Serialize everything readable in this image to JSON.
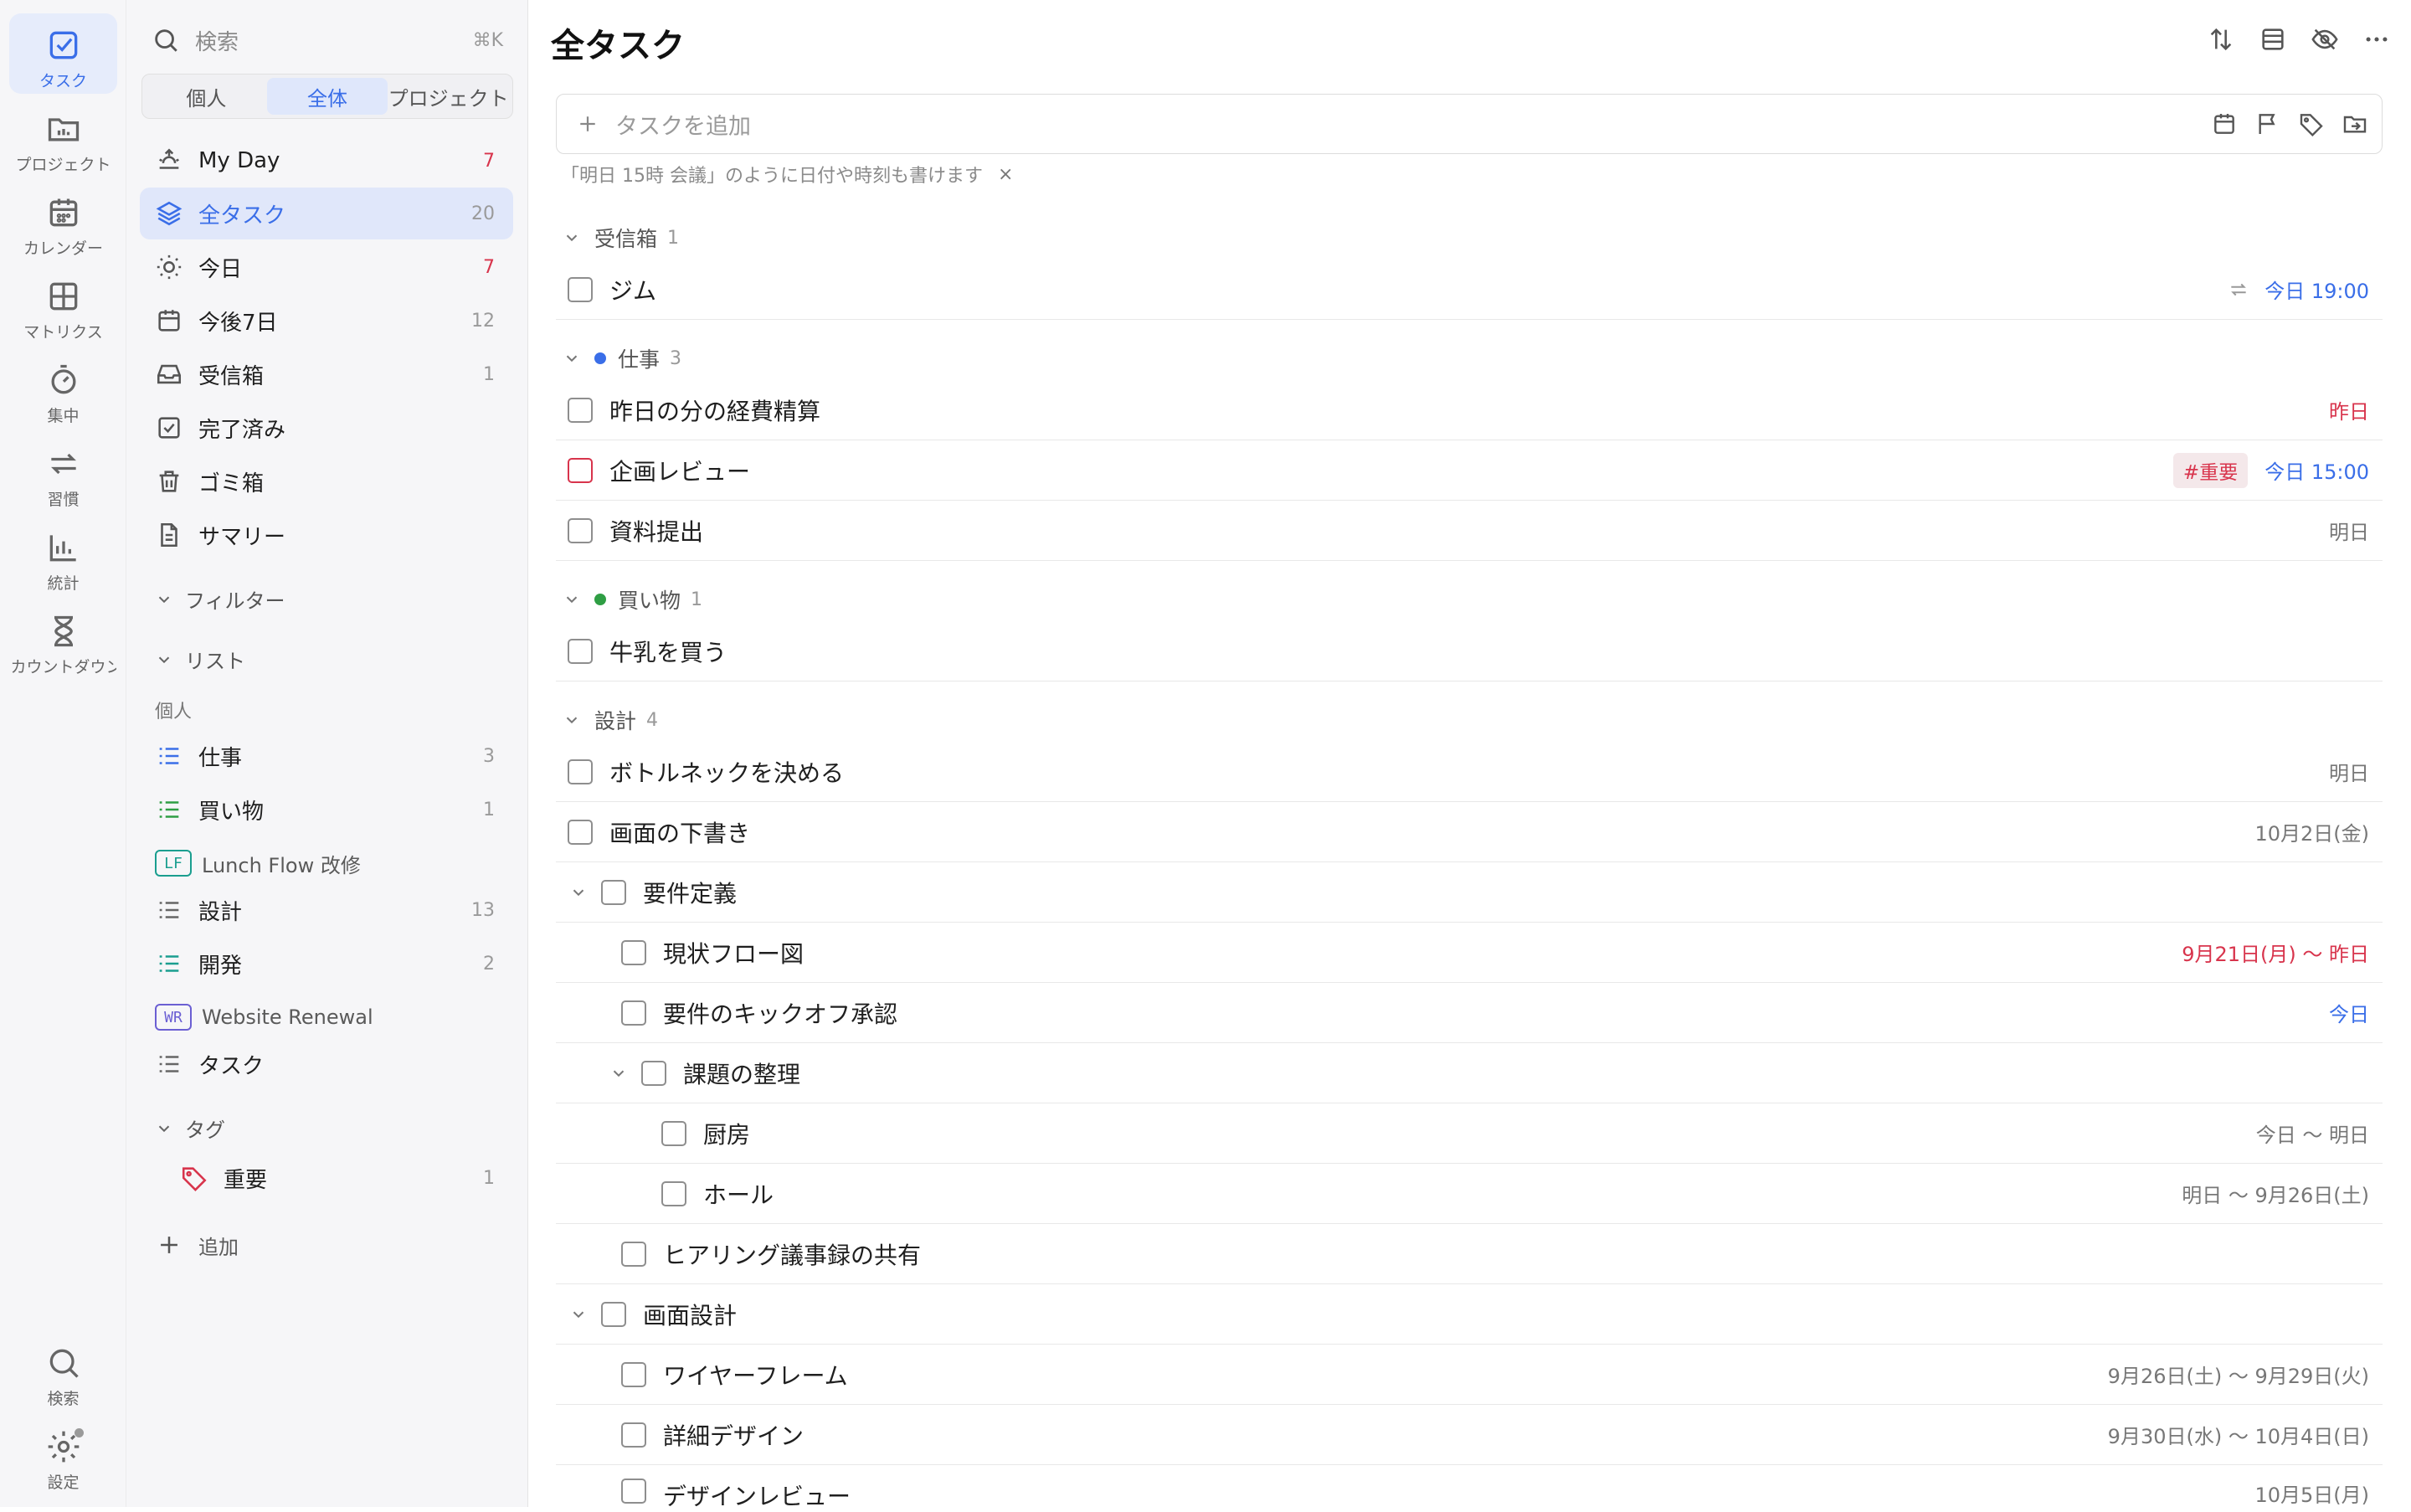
{
  "rail": {
    "tasks": "タスク",
    "projects": "プロジェクト",
    "calendar": "カレンダー",
    "matrix": "マトリクス",
    "focus": "集中",
    "habits": "習慣",
    "stats": "統計",
    "countdown": "カウントダウン",
    "search": "検索",
    "settings": "設定"
  },
  "sidebar": {
    "search_placeholder": "検索",
    "search_shortcut": "⌘K",
    "segments": [
      "個人",
      "全体",
      "プロジェクト"
    ],
    "nav": [
      {
        "label": "My Day",
        "count": "7"
      },
      {
        "label": "全タスク",
        "count": "20"
      },
      {
        "label": "今日",
        "count": "7"
      },
      {
        "label": "今後7日",
        "count": "12"
      },
      {
        "label": "受信箱",
        "count": "1"
      },
      {
        "label": "完了済み",
        "count": ""
      },
      {
        "label": "ゴミ箱",
        "count": ""
      },
      {
        "label": "サマリー",
        "count": ""
      }
    ],
    "filters_label": "フィルター",
    "lists_label": "リスト",
    "personal_label": "個人",
    "lists": [
      {
        "label": "仕事",
        "count": "3"
      },
      {
        "label": "買い物",
        "count": "1"
      },
      {
        "label": "Lunch Flow 改修",
        "badge": "LF"
      },
      {
        "label": "設計",
        "count": "13"
      },
      {
        "label": "開発",
        "count": "2"
      },
      {
        "label": "Website Renewal",
        "badge": "WR"
      },
      {
        "label": "タスク",
        "count": ""
      }
    ],
    "tags_label": "タグ",
    "tags": [
      {
        "label": "重要",
        "count": "1"
      }
    ],
    "add_label": "追加"
  },
  "main": {
    "title": "全タスク",
    "add_placeholder": "タスクを追加",
    "hint": "「明日 15時 会議」のように日付や時刻も書けます",
    "hint_close": "×",
    "groups": [
      {
        "name": "受信箱",
        "count": "1"
      },
      {
        "name": "仕事",
        "count": "3"
      },
      {
        "name": "買い物",
        "count": "1"
      },
      {
        "name": "設計",
        "count": "4"
      }
    ],
    "tasks": [
      {
        "title": "ジム",
        "date": "今日 19:00"
      },
      {
        "title": "昨日の分の経費精算",
        "date": "昨日"
      },
      {
        "title": "企画レビュー",
        "tag": "#重要",
        "date": "今日 15:00"
      },
      {
        "title": "資料提出",
        "date": "明日"
      },
      {
        "title": "牛乳を買う",
        "date": ""
      },
      {
        "title": "ボトルネックを決める",
        "date": "明日"
      },
      {
        "title": "画面の下書き",
        "date": "10月2日(金)"
      },
      {
        "title": "要件定義",
        "date": ""
      },
      {
        "title": "現状フロー図",
        "date": "9月21日(月) 〜 昨日"
      },
      {
        "title": "要件のキックオフ承認",
        "date": "今日"
      },
      {
        "title": "課題の整理",
        "date": ""
      },
      {
        "title": "厨房",
        "date": "今日 〜 明日"
      },
      {
        "title": "ホール",
        "date": "明日 〜 9月26日(土)"
      },
      {
        "title": "ヒアリング議事録の共有",
        "date": ""
      },
      {
        "title": "画面設計",
        "date": ""
      },
      {
        "title": "ワイヤーフレーム",
        "date": "9月26日(土) 〜 9月29日(火)"
      },
      {
        "title": "詳細デザイン",
        "date": "9月30日(水) 〜 10月4日(日)"
      },
      {
        "title": "デザインレビュー",
        "date": "10月5日(月)"
      }
    ]
  },
  "colors": {
    "accent": "#3a6ee8",
    "danger": "#d8344c",
    "work_dot": "#3a6ee8",
    "shopping_dot": "#2f9e44",
    "lf_badge": "#1a9e8f",
    "wr_badge": "#6b5fd3"
  }
}
